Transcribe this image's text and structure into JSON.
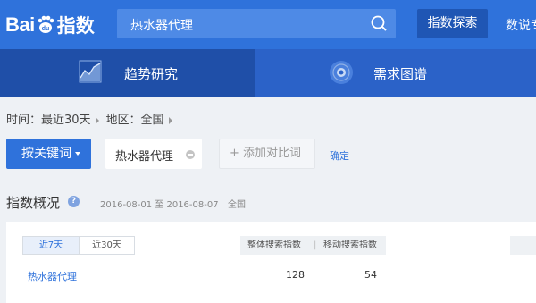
{
  "header": {
    "logo_text": "Bai",
    "logo_du": "du",
    "logo_cn": "指数",
    "search_value": "热水器代理",
    "explore_label": "指数探索",
    "nav_more": "数说专"
  },
  "tabs": [
    {
      "label": "趋势研究",
      "active": true,
      "icon": "trend-chart-icon"
    },
    {
      "label": "需求图谱",
      "active": false,
      "icon": "demand-graph-icon"
    }
  ],
  "filters": {
    "time_label": "时间：最近30天",
    "region_label": "地区：全国"
  },
  "keywords": {
    "button_label": "按关键词",
    "chip": "热水器代理",
    "add_compare": "+ 添加对比词",
    "confirm": "确定"
  },
  "overview": {
    "title": "指数概况",
    "date_range": "2016-08-01 至 2016-08-07",
    "region": "全国",
    "range_tabs": [
      "近7天",
      "近30天"
    ],
    "columns": [
      "整体搜索指数",
      "|",
      "移动搜索指数"
    ],
    "rows": [
      {
        "keyword": "热水器代理",
        "overall": "128",
        "mobile": "54"
      }
    ]
  },
  "colors": {
    "brand_blue": "#2f72db",
    "tab_active": "#1f4fa8"
  }
}
